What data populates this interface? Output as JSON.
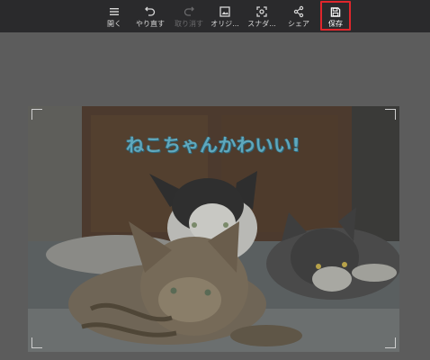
{
  "toolbar": {
    "items": [
      {
        "label": "開く",
        "icon": "menu-icon",
        "state": "normal"
      },
      {
        "label": "やり直す",
        "icon": "undo-icon",
        "state": "normal"
      },
      {
        "label": "取り消す",
        "icon": "redo-icon",
        "state": "disabled"
      },
      {
        "label": "オリジ...",
        "icon": "image-icon",
        "state": "normal"
      },
      {
        "label": "スナダ...",
        "icon": "screenshot-icon",
        "state": "normal"
      },
      {
        "label": "シェア",
        "icon": "share-icon",
        "state": "normal"
      },
      {
        "label": "保存",
        "icon": "save-icon",
        "state": "active"
      }
    ],
    "active_color": "#e0262c"
  },
  "canvas": {
    "overlay_text": "ねこちゃんかわいい!",
    "overlay_color": "#5fa8bd"
  }
}
